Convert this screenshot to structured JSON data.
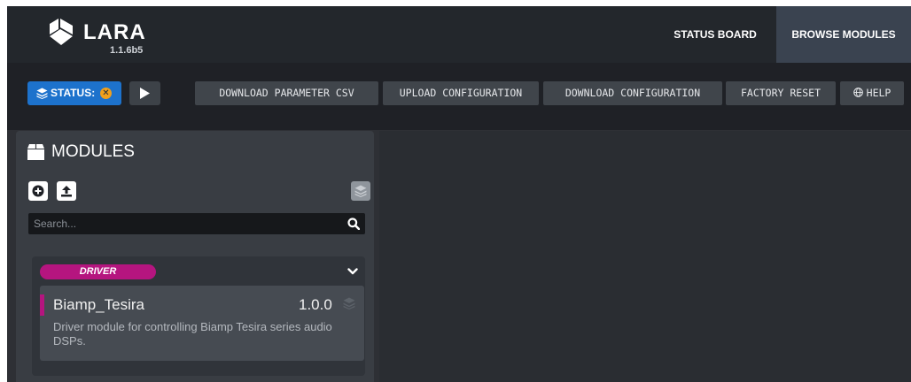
{
  "app": {
    "name": "LARA",
    "version": "1.1.6b5"
  },
  "nav": {
    "tabs": [
      {
        "label": "STATUS BOARD"
      },
      {
        "label": "BROWSE MODULES"
      }
    ],
    "active": "BROWSE MODULES"
  },
  "toolbar": {
    "status_label": "STATUS:",
    "status_icon": "x-circle-icon",
    "play_icon": "play-icon",
    "download_csv_label": "DOWNLOAD PARAMETER CSV",
    "upload_config_label": "UPLOAD CONFIGURATION",
    "download_config_label": "DOWNLOAD CONFIGURATION",
    "factory_reset_label": "FACTORY RESET",
    "help_label": "HELP"
  },
  "modules": {
    "title": "MODULES",
    "search_placeholder": "Search...",
    "groups": [
      {
        "label": "DRIVER",
        "color": "#b5157f",
        "items": [
          {
            "name": "Biamp_Tesira",
            "version": "1.0.0",
            "description": "Driver module for controlling Biamp Tesira series audio DSPs."
          }
        ]
      }
    ]
  },
  "colors": {
    "accent": "#1d72cc",
    "status_warning": "#f0a01c",
    "driver": "#b5157f"
  }
}
